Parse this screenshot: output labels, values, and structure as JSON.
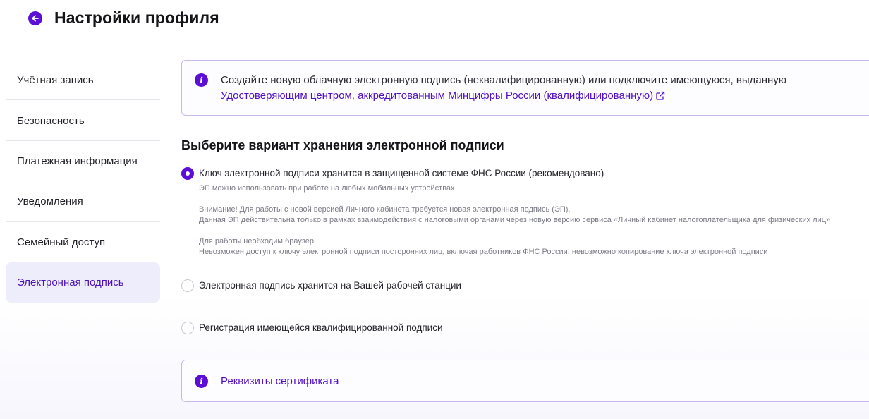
{
  "header": {
    "title": "Настройки профиля",
    "back_icon": "arrow-left-icon"
  },
  "sidebar": {
    "items": [
      {
        "label": "Учётная запись",
        "active": false
      },
      {
        "label": "Безопасность",
        "active": false
      },
      {
        "label": "Платежная информация",
        "active": false
      },
      {
        "label": "Уведомления",
        "active": false
      },
      {
        "label": "Семейный доступ",
        "active": false
      },
      {
        "label": "Электронная подпись",
        "active": true
      }
    ]
  },
  "info_notice": {
    "icon": "info-icon",
    "text": "Создайте новую облачную электронную подпись (неквалифицированную) или подключите имеющуюся, выданную",
    "link_text": "Удостоверяющим центром, аккредитованным Минцифры России (квалифицированную)",
    "link_icon": "external-link-icon"
  },
  "section": {
    "title": "Выберите вариант хранения электронной подписи"
  },
  "options": [
    {
      "label": "Ключ электронной подписи хранится в защищенной системе ФНС России (рекомендовано)",
      "checked": true,
      "desc_1": "ЭП можно использовать при работе на любых мобильных устройствах",
      "desc_2": "Внимание! Для работы с новой версией Личного кабинета требуется новая электронная подпись (ЭП).",
      "desc_3": "Данная ЭП действительна только в рамках взаимодействия с налоговыми органами через новую версию сервиса «Личный кабинет налогоплательщика для физических лиц»",
      "desc_4": "Для работы необходим браузер.",
      "desc_5": "Невозможен доступ к ключу электронной подписи посторонних лиц, включая работников ФНС России, невозможно копирование ключа электронной подписи"
    },
    {
      "label": "Электронная подпись хранится на Вашей рабочей станции",
      "checked": false
    },
    {
      "label": "Регистрация имеющейся квалифицированной подписи",
      "checked": false
    }
  ],
  "certificate": {
    "icon": "info-icon",
    "label": "Реквизиты сертификата"
  },
  "colors": {
    "accent": "#5b0fd6",
    "link": "#5210c6",
    "active_bg": "#eeedfb",
    "border": "#c9b8ee"
  }
}
